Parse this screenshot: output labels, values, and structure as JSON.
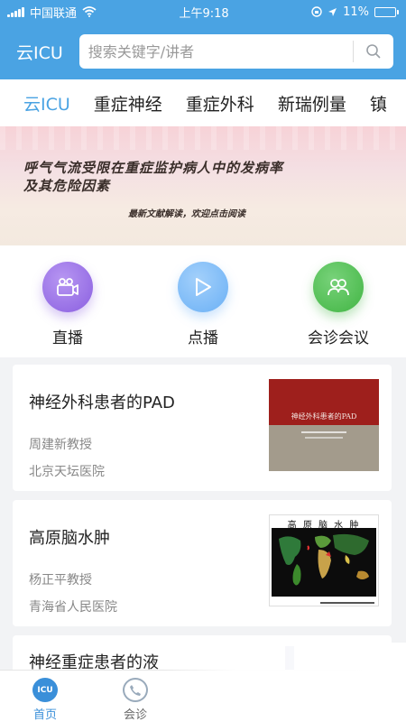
{
  "status": {
    "carrier": "中国联通",
    "time": "上午9:18",
    "battery": "11%",
    "battery_level": 0.11
  },
  "header": {
    "brand": "云ICU",
    "search_placeholder": "搜索关键字/讲者"
  },
  "tabs": [
    {
      "label": "云ICU",
      "active": true
    },
    {
      "label": "重症神经"
    },
    {
      "label": "重症外科"
    },
    {
      "label": "新瑞例量"
    },
    {
      "label": "镇"
    }
  ],
  "banner": {
    "line1": "呼气气流受限在重症监护病人中的发病率",
    "line2": "及其危险因素",
    "sub": "最新文献解读，欢迎点击阅读"
  },
  "quick": [
    {
      "label": "直播",
      "icon": "video-camera-icon",
      "color": "#8a5fe0"
    },
    {
      "label": "点播",
      "icon": "play-icon",
      "color": "#6ab0f5"
    },
    {
      "label": "会诊会议",
      "icon": "group-icon",
      "color": "#41b543"
    }
  ],
  "cards": [
    {
      "title": "神经外科患者的PAD",
      "speaker": "周建新教授",
      "hospital": "北京天坛医院",
      "thumb_title": "神经外科患者的PAD"
    },
    {
      "title": "高原脑水肿",
      "speaker": "杨正平教授",
      "hospital": "青海省人民医院",
      "thumb_title": "高 原 脑 水 肿"
    },
    {
      "title": "神经重症患者的液"
    }
  ],
  "tabbar": [
    {
      "label": "首页",
      "icon": "icu-icon",
      "active": true
    },
    {
      "label": "会诊"
    }
  ]
}
